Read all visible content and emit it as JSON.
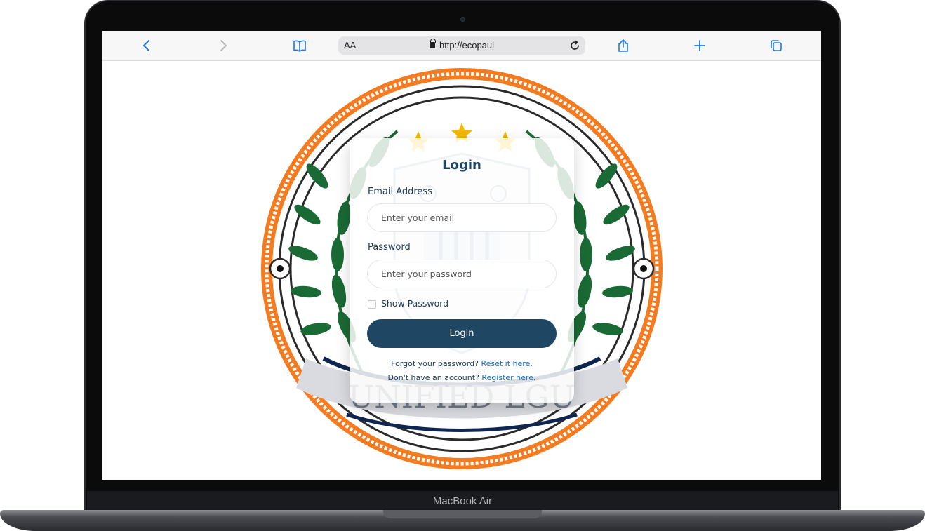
{
  "device": {
    "brand": "MacBook Air"
  },
  "browser": {
    "text_size_label": "AA",
    "url": "http://ecopaul",
    "icons": [
      "chevron-left-icon",
      "chevron-right-icon",
      "book-icon",
      "lock-icon",
      "reload-icon",
      "share-icon",
      "plus-icon",
      "tabs-icon"
    ]
  },
  "seal": {
    "banner_text": "UNIFIED LGU",
    "colors": {
      "outer_ring": "#f47b20",
      "laurel": "#1a6a35",
      "navy": "#0f2750",
      "star": "#f5b800"
    }
  },
  "login": {
    "title": "Login",
    "email_label": "Email Address",
    "email_placeholder": "Enter your email",
    "password_label": "Password",
    "password_placeholder": "Enter your password",
    "show_password_label": "Show Password",
    "submit_label": "Login",
    "forgot_text": "Forgot your password?",
    "forgot_link": "Reset it here",
    "register_text": "Don't have an account?",
    "register_link": "Register here",
    "colors": {
      "button": "#1f4662",
      "link": "#1e6fb8"
    }
  }
}
